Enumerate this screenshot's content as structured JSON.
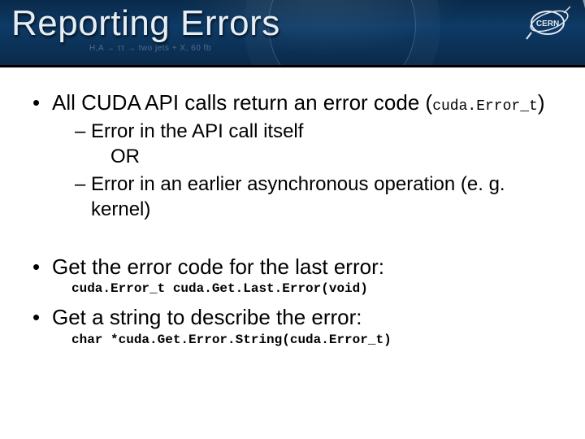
{
  "header": {
    "title": "Reporting Errors",
    "blueprint_text": "H,A → ττ → two jets + X, 60 fb",
    "logo_label": "CERN"
  },
  "content": {
    "b1": {
      "text_a": "All CUDA API calls return an error code (",
      "code": "cuda.Error_t",
      "text_b": ")",
      "sub1": "Error in the API call itself",
      "or": "OR",
      "sub2": "Error in an earlier asynchronous operation (e. g. kernel)"
    },
    "b2": {
      "text": "Get the error code for the last error:",
      "code": "cuda.Error_t cuda.Get.Last.Error(void)"
    },
    "b3": {
      "text": "Get a string to describe the error:",
      "code": "char *cuda.Get.Error.String(cuda.Error_t)"
    }
  }
}
